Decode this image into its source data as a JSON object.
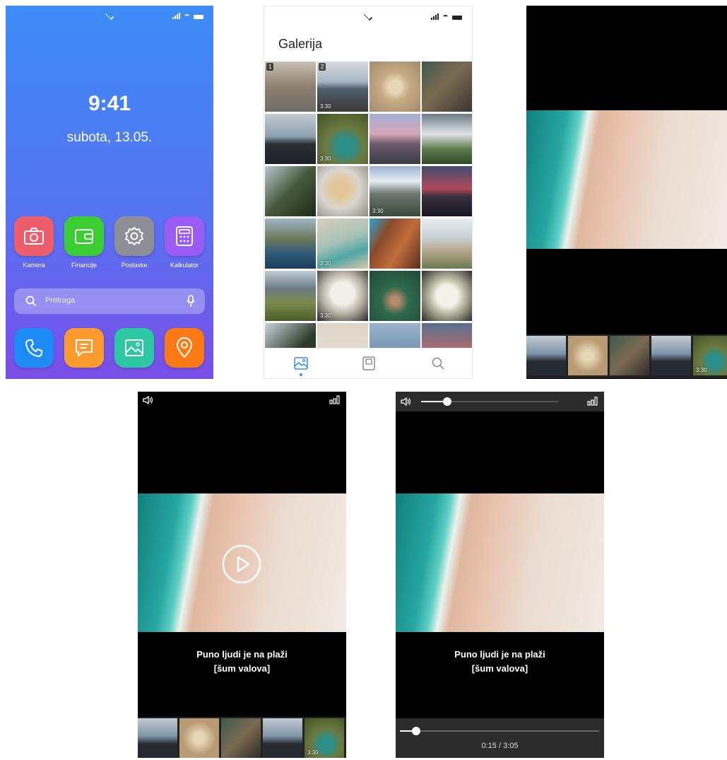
{
  "home": {
    "time": "9:41",
    "date": "subota, 13.05.",
    "apps": [
      {
        "label": "Kamera",
        "icon": "camera-icon",
        "color": "#ee5d6c"
      },
      {
        "label": "Financije",
        "icon": "wallet-icon",
        "color": "#3ccd32"
      },
      {
        "label": "Postavke",
        "icon": "gear-icon",
        "color": "#8e8e99"
      },
      {
        "label": "Kalkulator",
        "icon": "calculator-icon",
        "color": "#9a5cf4"
      }
    ],
    "search_placeholder": "Pretraga",
    "dock": [
      {
        "icon": "phone-icon",
        "color": "#1e8af5"
      },
      {
        "icon": "message-icon",
        "color": "#fb9b2f"
      },
      {
        "icon": "gallery-icon",
        "color": "#2ec7a3"
      },
      {
        "icon": "location-icon",
        "color": "#fb7a16"
      }
    ]
  },
  "gallery": {
    "title": "Galerija",
    "badges": {
      "first": "1",
      "second": "2"
    },
    "video_duration": "3:30",
    "nav": [
      "gallery-icon",
      "album-icon",
      "search-icon"
    ]
  },
  "viewer": {
    "strip_duration": "3:30"
  },
  "player": {
    "caption_line1": "Puno ljudi je na plaži",
    "caption_line2": "[šum valova]",
    "strip_duration": "3:30",
    "time_readout": "0:15 / 3:05",
    "progress": 0.082,
    "volume": 0.19
  }
}
